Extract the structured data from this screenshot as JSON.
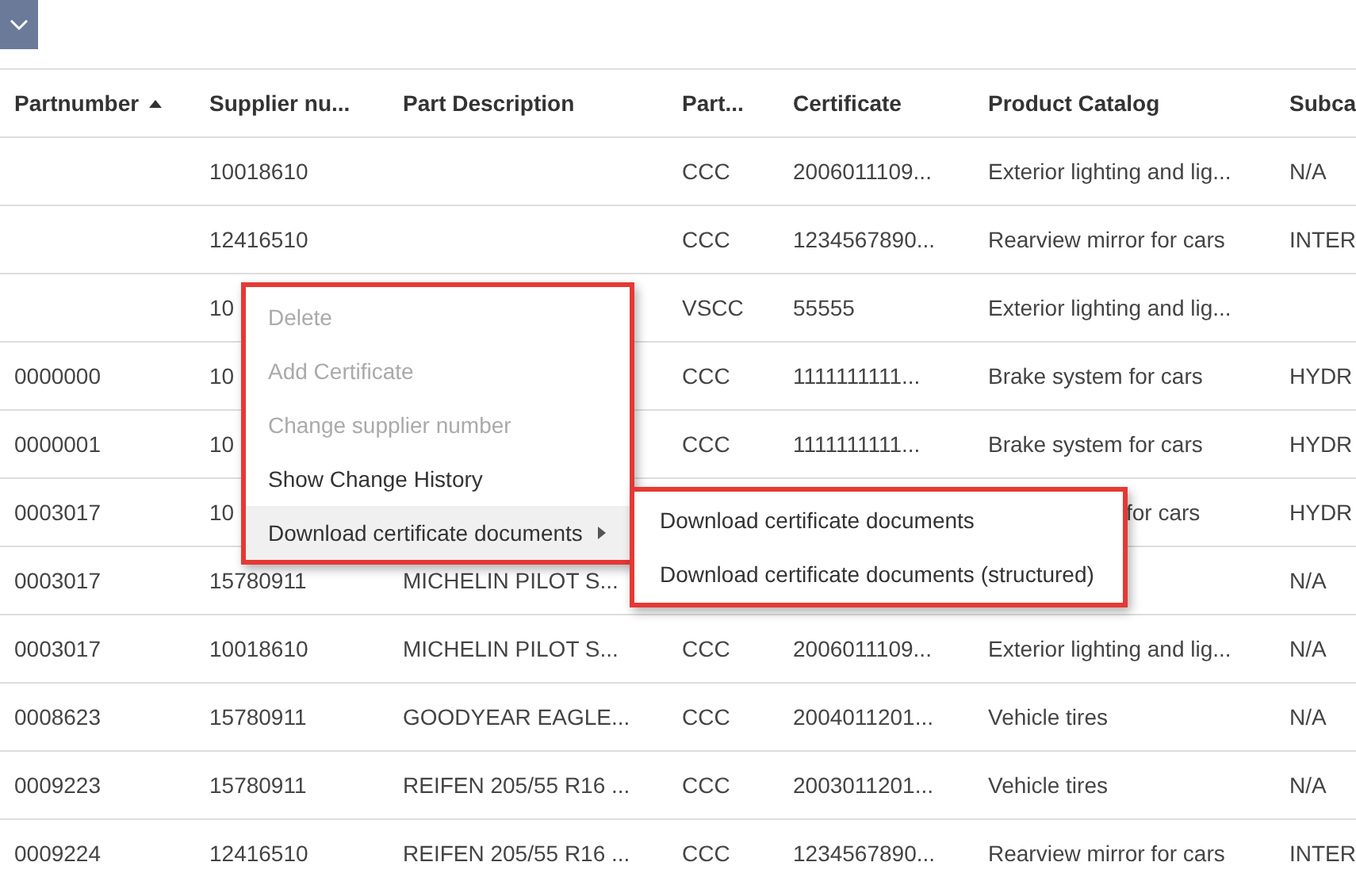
{
  "columns": [
    {
      "label": "Partnumber",
      "sorted": true
    },
    {
      "label": "Supplier nu...",
      "sorted": false
    },
    {
      "label": "Part Description",
      "sorted": false
    },
    {
      "label": "Part...",
      "sorted": false
    },
    {
      "label": "Certificate",
      "sorted": false
    },
    {
      "label": "Product Catalog",
      "sorted": false
    },
    {
      "label": "Subca",
      "sorted": false
    }
  ],
  "rows": [
    [
      null,
      "10018610",
      null,
      "CCC",
      "2006011109...",
      "Exterior lighting and lig...",
      "N/A"
    ],
    [
      null,
      "12416510",
      null,
      "CCC",
      "1234567890...",
      "Rearview mirror for cars",
      "INTER"
    ],
    [
      null,
      "10",
      null,
      "VSCC",
      "55555",
      "Exterior lighting and lig...",
      null
    ],
    [
      "0000000",
      "10",
      null,
      "CCC",
      "1111111111...",
      "Brake system for cars",
      "HYDR"
    ],
    [
      "0000001",
      "10",
      null,
      "CCC",
      "1111111111...",
      "Brake system for cars",
      "HYDR"
    ],
    [
      "0003017",
      "10",
      null,
      null,
      null,
      {
        "text": "for cars",
        "covered": true
      },
      "HYDR"
    ],
    [
      "0003017",
      "15780911",
      "MICHELIN PILOT S...",
      null,
      null,
      null,
      "N/A"
    ],
    [
      "0003017",
      "10018610",
      "MICHELIN PILOT S...",
      "CCC",
      "2006011109...",
      "Exterior lighting and lig...",
      "N/A"
    ],
    [
      "0008623",
      "15780911",
      "GOODYEAR EAGLE...",
      "CCC",
      "2004011201...",
      "Vehicle tires",
      "N/A"
    ],
    [
      "0009223",
      "15780911",
      "REIFEN 205/55 R16 ...",
      "CCC",
      "2003011201...",
      "Vehicle tires",
      "N/A"
    ],
    [
      "0009224",
      "12416510",
      "REIFEN 205/55 R16 ...",
      "CCC",
      "1234567890...",
      "Rearview mirror for cars",
      "INTER"
    ]
  ],
  "context_menu": {
    "items": [
      {
        "label": "Delete",
        "disabled": true,
        "highlighted": false,
        "submenu": false
      },
      {
        "label": "Add Certificate",
        "disabled": true,
        "highlighted": false,
        "submenu": false
      },
      {
        "label": "Change supplier number",
        "disabled": true,
        "highlighted": false,
        "submenu": false
      },
      {
        "label": "Show Change History",
        "disabled": false,
        "highlighted": false,
        "submenu": false
      },
      {
        "label": "Download certificate documents",
        "disabled": false,
        "highlighted": true,
        "submenu": true
      }
    ],
    "submenu": {
      "items": [
        {
          "label": "Download certificate documents"
        },
        {
          "label": "Download certificate documents (structured)"
        }
      ]
    }
  }
}
